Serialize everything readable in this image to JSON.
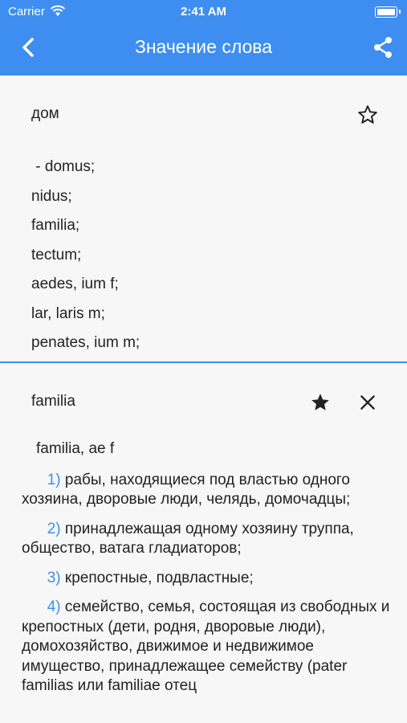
{
  "status_bar": {
    "carrier": "Carrier",
    "time": "2:41 AM"
  },
  "header": {
    "title": "Значение слова"
  },
  "entry1": {
    "word": "дом",
    "favorite": false,
    "translations": [
      " - domus;",
      "nidus;",
      "familia;",
      "tectum;",
      "aedes, ium f;",
      "lar, laris m;",
      "penates, ium m;"
    ]
  },
  "entry2": {
    "word": "familia",
    "favorite": true,
    "headword": "familia, ae f",
    "senses": [
      {
        "num": "1)",
        "text": "рабы, находящиеся под властью одного хозяина, дворовые люди, челядь, домочадцы;"
      },
      {
        "num": "2)",
        "text": "принадлежащая одному хозяину труппа, общество, ватага гладиаторов;"
      },
      {
        "num": "3)",
        "text": "крепостные, подвластные;"
      },
      {
        "num": "4)",
        "text": "семейство, семья, состоящая из свободных и крепостных (дети, родня, дворовые люди), домохозяйство, движимое и недвижимое имущество, принадлежащее семейству (pater familias или familiae отец"
      }
    ]
  },
  "icons": {
    "back": "chevron-left-icon",
    "share": "share-icon",
    "star_outline": "star-outline-icon",
    "star_filled": "star-filled-icon",
    "close": "close-icon",
    "wifi": "wifi-icon",
    "battery": "battery-icon"
  },
  "colors": {
    "accent": "#3d8ef0",
    "background": "#f7f7f7",
    "text": "#222222"
  }
}
